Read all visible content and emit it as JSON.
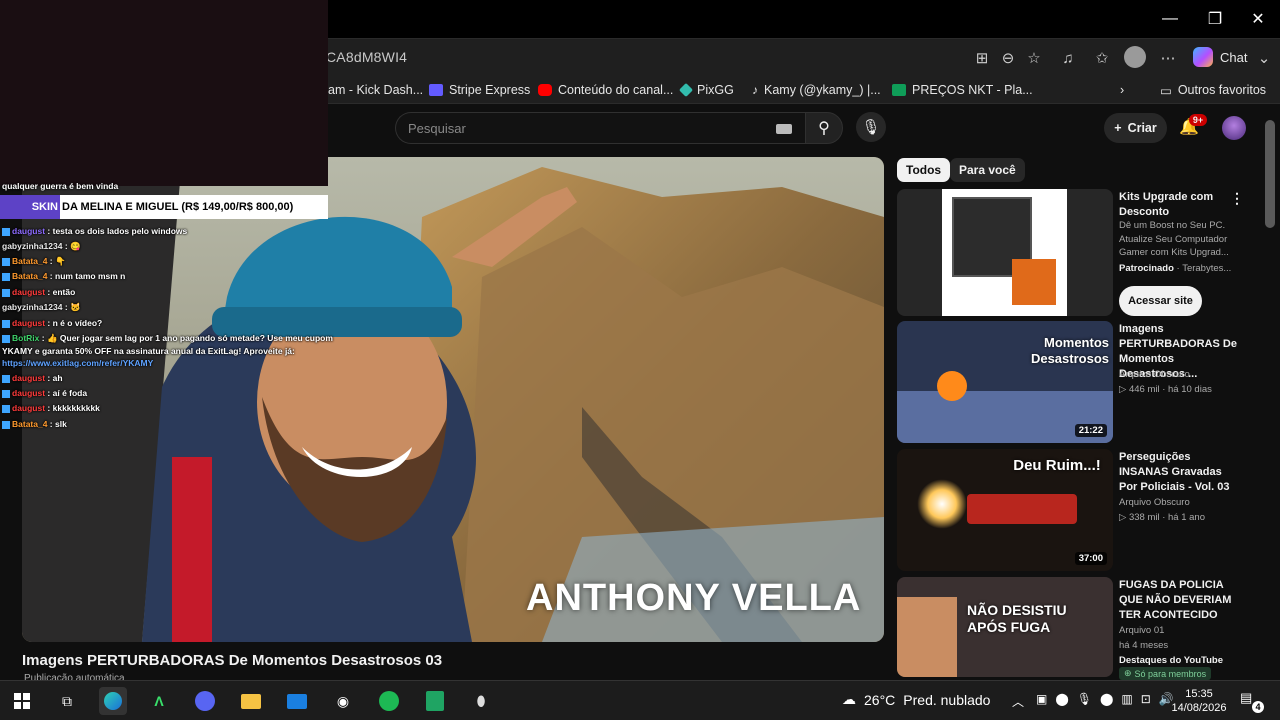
{
  "browser": {
    "url_fragment": "CA8dM8WI4",
    "chat_label": "Chat",
    "bookmarks": [
      {
        "label": "am - Kick Dash...",
        "color": "#000000"
      },
      {
        "label": "Stripe Express",
        "color": "#635bff"
      },
      {
        "label": "Conteúdo do canal...",
        "color": "#ff0000"
      },
      {
        "label": "PixGG",
        "color": "#32bcad"
      },
      {
        "label": "Kamy (@ykamy_) |...",
        "color": "#111111"
      },
      {
        "label": "PREÇOS NKT - Pla...",
        "color": "#0f9d58"
      }
    ],
    "other_favorites": "Outros favoritos"
  },
  "youtube": {
    "search_placeholder": "Pesquisar",
    "create_label": "Criar",
    "notif_badge": "9+",
    "chips": [
      "Todos",
      "Para você"
    ],
    "video": {
      "overlay_text": "ANTHONY VELLA",
      "title": "Imagens PERTURBADORAS De Momentos Desastrosos 03",
      "subtitle": "Publicação automática"
    },
    "sidebar": [
      {
        "kind": "ad",
        "title": "Kits Upgrade com Desconto",
        "desc": "Dê um Boost no Seu PC. Atualize Seu Computador Gamer com Kits Upgrad...",
        "sponsored": "Patrocinado",
        "advertiser": "Terabytes...",
        "cta": "Acessar site"
      },
      {
        "kind": "video",
        "thumb_text": "Momentos Desastrosos",
        "duration": "21:22",
        "title": "Imagens PERTURBADORAS De Momentos Desastrosos ...",
        "channel": "Arquivo Obscuro",
        "meta": "446 mil · há 10 dias"
      },
      {
        "kind": "video",
        "thumb_text": "Deu Ruim...!",
        "duration": "37:00",
        "title": "Perseguições INSANAS Gravadas Por Policiais - Vol. 03",
        "channel": "Arquivo Obscuro",
        "meta": "338 mil · há 1 ano"
      },
      {
        "kind": "video",
        "thumb_text": "NÃO DESISTIU APÓS FUGA",
        "title": "FUGAS DA POLICIA QUE NÃO DEVERIAM TER ACONTECIDO",
        "channel": "Arquivo 01",
        "meta": "há 4 meses",
        "extra": "Destaques do YouTube",
        "members": "Só para membros"
      }
    ]
  },
  "stream": {
    "skin_left": "SKIN",
    "skin_right": "DA MELINA E MIGUEL (R$ 149,00/R$ 800,00)",
    "chat": [
      {
        "user": "",
        "text": "qualquer guerra é bem vinda",
        "color": "gray"
      },
      {
        "user": "daugust",
        "text": "testa os dois lados pelo windows",
        "color": "purple"
      },
      {
        "user": "gabyzinha1234",
        "text": "😋",
        "color": "gray"
      },
      {
        "user": "Batata_4",
        "text": "👇",
        "color": "orange"
      },
      {
        "user": "Batata_4",
        "text": "num tamo msm n",
        "color": "orange"
      },
      {
        "user": "daugust",
        "text": "então",
        "color": "red"
      },
      {
        "user": "gabyzinha1234",
        "text": "🐱",
        "color": "gray"
      },
      {
        "user": "daugust",
        "text": "n é o vídeo?",
        "color": "red"
      },
      {
        "user": "BotRix",
        "text": "👍 Quer jogar sem lag por 1 ano pagando só metade? Use meu cupom",
        "color": "green"
      },
      {
        "user": "",
        "text": "YKAMY e garanta 50% OFF na assinatura anual da ExitLag! Aproveite já:",
        "color": "gray"
      },
      {
        "user": "",
        "text": "https://www.exitlag.com/refer/YKAMY",
        "color": "link"
      },
      {
        "user": "daugust",
        "text": "ah",
        "color": "red"
      },
      {
        "user": "daugust",
        "text": "aí é foda",
        "color": "red"
      },
      {
        "user": "daugust",
        "text": "kkkkkkkkkk",
        "color": "red"
      },
      {
        "user": "Batata_4",
        "text": "slk",
        "color": "orange"
      }
    ]
  },
  "taskbar": {
    "weather_temp": "26°C",
    "weather_desc": "Pred. nublado",
    "time": "15:35",
    "date": "14/08/2026",
    "notif_count": "4"
  }
}
